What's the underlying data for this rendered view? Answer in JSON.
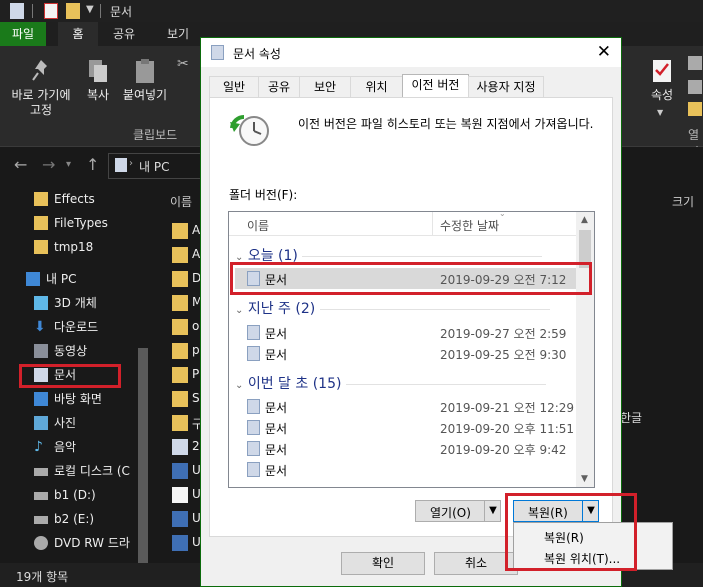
{
  "explorer": {
    "window_title": "문서",
    "ribbon_tabs": [
      "파일",
      "홈",
      "공유",
      "보기"
    ],
    "ribbon": {
      "pin_label": "바로 가기에\n고정",
      "copy_label": "복사",
      "paste_label": "붙여넣기",
      "clipboard_group": "클립보드",
      "properties_label": "속성",
      "right_group_partial": "열기"
    },
    "address": "내 PC",
    "nav_items": [
      "Effects",
      "FileTypes",
      "tmp18",
      "내 PC",
      "3D 개체",
      "다운로드",
      "동영상",
      "문서",
      "바탕 화면",
      "사진",
      "음악",
      "로컬 디스크 (C",
      "b1 (D:)",
      "b2 (E:)",
      "DVD RW 드라"
    ],
    "list_header_name": "이름",
    "list_header_size": "크기",
    "file_rows": [
      "A",
      "A",
      "D",
      "M",
      "o",
      "p",
      "P",
      "S",
      "구",
      "20",
      "U",
      "U",
      "U",
      "U",
      "U",
      "글",
      "U"
    ],
    "partial_right_text": "한글",
    "status_text": "19개 항목"
  },
  "dialog": {
    "title": "문서 속성",
    "close_glyph": "✕",
    "tabs": [
      "일반",
      "공유",
      "보안",
      "위치",
      "이전 버전",
      "사용자 지정"
    ],
    "active_tab": "이전 버전",
    "description": "이전 버전은 파일 히스토리 또는 복원 지점에서 가져옵니다.",
    "folder_versions_label": "폴더 버전(F):",
    "columns": {
      "name": "이름",
      "modified": "수정한 날짜"
    },
    "groups": [
      {
        "label": "오늘 (1)",
        "items": [
          {
            "name": "문서",
            "date": "2019-09-29 오전 7:12"
          }
        ]
      },
      {
        "label": "지난 주 (2)",
        "items": [
          {
            "name": "문서",
            "date": "2019-09-27 오전 2:59"
          },
          {
            "name": "문서",
            "date": "2019-09-25 오전 9:30"
          }
        ]
      },
      {
        "label": "이번 달 초 (15)",
        "items": [
          {
            "name": "문서",
            "date": "2019-09-21 오전 12:29"
          },
          {
            "name": "문서",
            "date": "2019-09-20 오후 11:51"
          },
          {
            "name": "문서",
            "date": "2019-09-20 오후 9:42"
          },
          {
            "name": "문서",
            "date": ""
          }
        ]
      }
    ],
    "open_button": "열기(O)",
    "restore_button": "복원(R)",
    "ok_button": "확인",
    "cancel_button": "취소",
    "restore_menu": [
      "복원(R)",
      "복원 위치(T)..."
    ]
  },
  "colors": {
    "highlight_red": "#d2202a",
    "file_tab_green": "#1a7a1a",
    "group_header_blue": "#1e3287",
    "folder_yellow": "#e8c15a"
  }
}
